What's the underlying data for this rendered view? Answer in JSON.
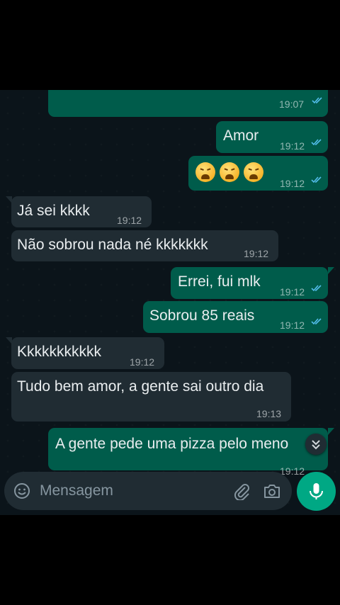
{
  "theme": {
    "outgoing": "#005c4b",
    "incoming": "#202c33",
    "accent": "#00a884",
    "read_ticks": "#53bdeb"
  },
  "messages": [
    {
      "dir": "out",
      "text": "",
      "time": "19:07"
    },
    {
      "dir": "out",
      "text": "Amor",
      "time": "19:12"
    },
    {
      "dir": "out",
      "emoji": [
        "tired-face",
        "tired-face",
        "tired-face"
      ],
      "time": "19:12"
    },
    {
      "dir": "in",
      "text": "Já sei kkkk",
      "time": "19:12"
    },
    {
      "dir": "in",
      "text": "Não sobrou nada né kkkkkkk",
      "time": "19:12"
    },
    {
      "dir": "out",
      "text": "Errei, fui mlk",
      "time": "19:12"
    },
    {
      "dir": "out",
      "text": "Sobrou 85 reais",
      "time": "19:12"
    },
    {
      "dir": "in",
      "text": "Kkkkkkkkkkk",
      "time": "19:12"
    },
    {
      "dir": "in",
      "text": "Tudo bem amor, a gente sai outro dia",
      "time": "19:13"
    },
    {
      "dir": "out",
      "text": "A gente pede uma pizza pelo meno",
      "time": "19:12"
    }
  ],
  "composer": {
    "placeholder": "Mensagem",
    "icons": [
      "emoji-icon",
      "attach-icon",
      "camera-icon",
      "mic-icon"
    ]
  },
  "scroll_down_icon": "chevron-double-down-icon"
}
